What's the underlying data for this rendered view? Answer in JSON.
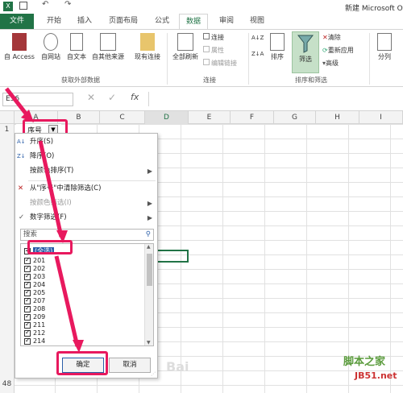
{
  "title_bar": {
    "doc_title": "新建 Microsoft Of"
  },
  "tabs": [
    "文件",
    "开始",
    "插入",
    "页面布局",
    "公式",
    "数据",
    "审阅",
    "视图"
  ],
  "ribbon": {
    "get_external": {
      "from_access": "自 Access",
      "from_web": "自网站",
      "from_text": "自文本",
      "from_other": "自其他来源",
      "existing": "现有连接",
      "group_label": "获取外部数据"
    },
    "connections": {
      "refresh_all": "全部刷新",
      "connections": "连接",
      "properties": "属性",
      "edit_links": "编辑链接",
      "group_label": "连接"
    },
    "sort_filter": {
      "sort": "排序",
      "filter": "筛选",
      "clear": "清除",
      "reapply": "重新应用",
      "advanced": "高级",
      "group_label": "排序和筛选"
    },
    "split": "分列"
  },
  "formula_bar": {
    "name_box": "E36",
    "fx": "fx"
  },
  "columns": [
    "A",
    "B",
    "C",
    "D",
    "E",
    "F",
    "G",
    "H",
    "I"
  ],
  "rows": [
    "1"
  ],
  "bottom_row": "48",
  "header_cell": "序号",
  "filter_menu": {
    "sort_asc": "升序(S)",
    "sort_desc": "降序(O)",
    "sort_color": "按颜色排序(T)",
    "clear_filter": "从\"序号\"中清除筛选(C)",
    "color_filter": "按颜色筛选(I)",
    "number_filter": "数字筛选(F)",
    "search_placeholder": "搜索",
    "items": [
      "(全选)",
      "201",
      "202",
      "203",
      "204",
      "205",
      "207",
      "208",
      "209",
      "211",
      "212",
      "214"
    ],
    "ok": "确定",
    "cancel": "取消"
  },
  "watermark": {
    "site": "脚本之家",
    "url": "JB51.net",
    "baidu": "Bai"
  },
  "colors": {
    "accent": "#217346",
    "highlight": "#e8195e"
  }
}
